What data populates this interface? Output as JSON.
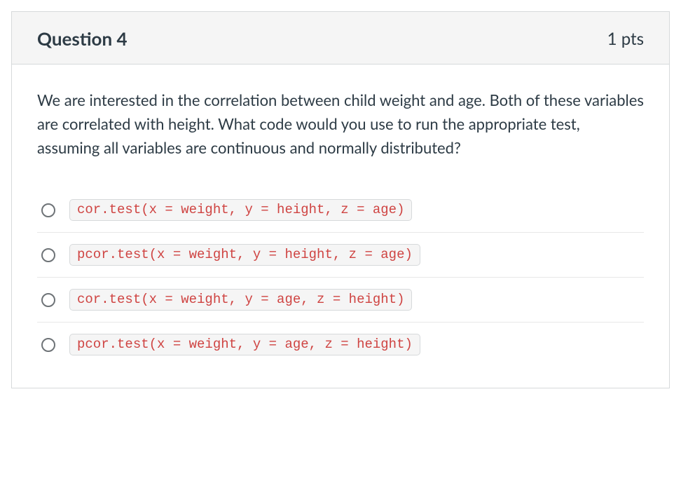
{
  "header": {
    "title": "Question 4",
    "points": "1 pts"
  },
  "body": {
    "prompt": "We are interested in the correlation between child weight and age. Both of these variables are correlated with height. What code would you use to run the appropriate test, assuming all variables are continuous and normally distributed?"
  },
  "answers": [
    {
      "code": "cor.test(x = weight, y = height, z = age)"
    },
    {
      "code": "pcor.test(x = weight, y = height, z = age)"
    },
    {
      "code": "cor.test(x = weight, y = age, z = height)"
    },
    {
      "code": "pcor.test(x = weight, y = age, z = height)"
    }
  ]
}
